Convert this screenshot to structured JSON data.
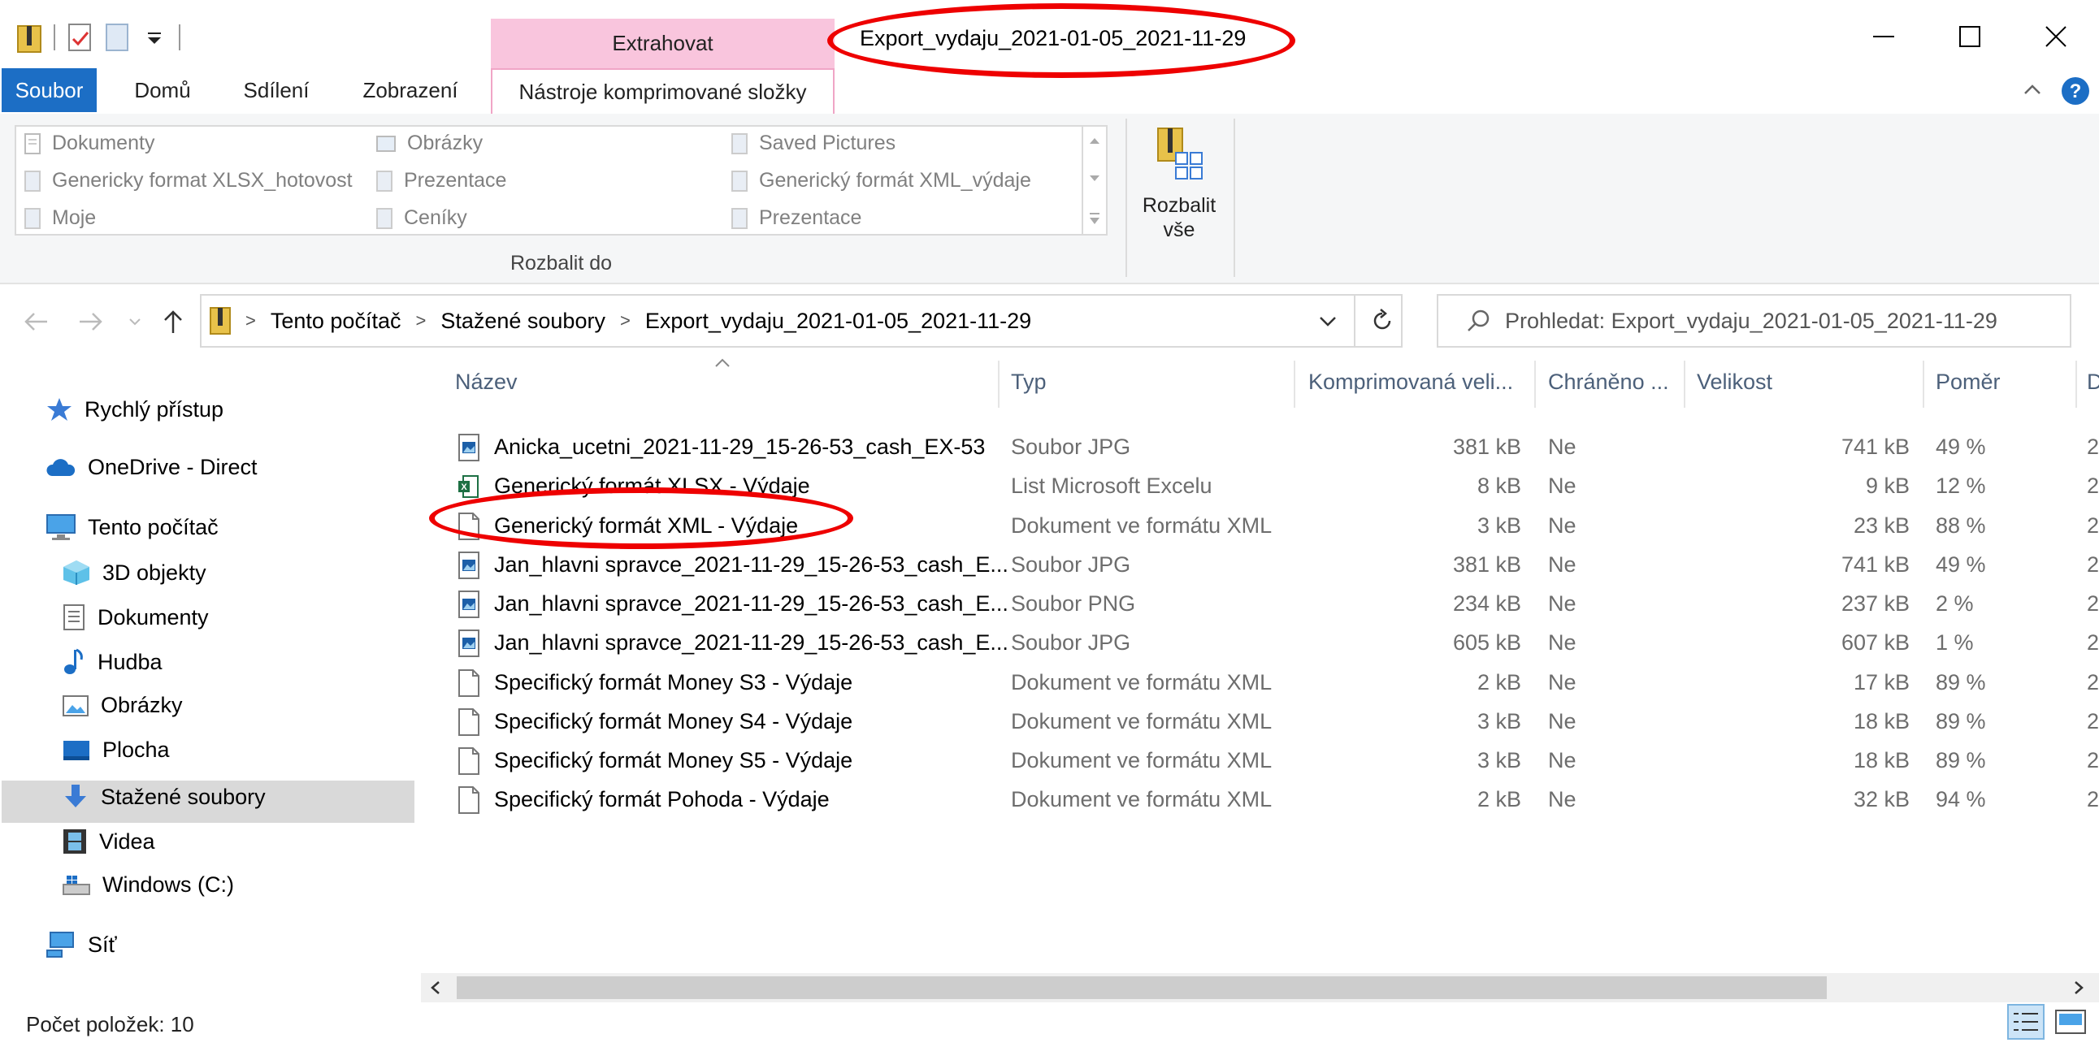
{
  "window": {
    "title": "Export_vydaju_2021-01-05_2021-11-29",
    "context_tab_group": "Extrahovat",
    "minimize_glyph": "—",
    "maximize_glyph": "☐",
    "close_glyph": "✕"
  },
  "ribbon_tabs": {
    "file": "Soubor",
    "home": "Domů",
    "share": "Sdílení",
    "view": "Zobrazení",
    "compressed_tools": "Nástroje komprimované složky"
  },
  "ribbon": {
    "gallery": [
      "Dokumenty",
      "Obrázky",
      "Saved Pictures",
      "Genericky format XLSX_hotovost",
      "Prezentace",
      "Generický formát XML_výdaje",
      "Moje",
      "Ceníky",
      "Prezentace"
    ],
    "gallery_group_label": "Rozbalit do",
    "extract_all_line1": "Rozbalit",
    "extract_all_line2": "vše"
  },
  "address": {
    "crumbs": [
      "Tento počítač",
      "Stažené soubory",
      "Export_vydaju_2021-01-05_2021-11-29"
    ],
    "search_placeholder": "Prohledat: Export_vydaju_2021-01-05_2021-11-29"
  },
  "nav": {
    "quick_access": "Rychlý přístup",
    "onedrive": "OneDrive - Direct",
    "this_pc": "Tento počítač",
    "objects3d": "3D objekty",
    "documents": "Dokumenty",
    "music": "Hudba",
    "pictures": "Obrázky",
    "desktop": "Plocha",
    "downloads": "Stažené soubory",
    "videos": "Videa",
    "windows_c": "Windows (C:)",
    "network": "Síť"
  },
  "columns": {
    "name": "Název",
    "type": "Typ",
    "compressed_size": "Komprimovaná veli...",
    "protected": "Chráněno ...",
    "size": "Velikost",
    "ratio": "Poměr",
    "date": "D"
  },
  "files": [
    {
      "name": "Anicka_ucetni_2021-11-29_15-26-53_cash_EX-53",
      "type": "Soubor JPG",
      "compressed": "381 kB",
      "protected": "Ne",
      "size": "741 kB",
      "ratio": "49 %",
      "date": "2",
      "icon": "image-file-icon"
    },
    {
      "name": "Generický formát XLSX - Výdaje",
      "type": "List Microsoft Excelu",
      "compressed": "8 kB",
      "protected": "Ne",
      "size": "9 kB",
      "ratio": "12 %",
      "date": "2",
      "icon": "excel-file-icon"
    },
    {
      "name": "Generický formát XML - Výdaje",
      "type": "Dokument ve formátu XML",
      "compressed": "3 kB",
      "protected": "Ne",
      "size": "23 kB",
      "ratio": "88 %",
      "date": "2",
      "icon": "xml-file-icon"
    },
    {
      "name": "Jan_hlavni spravce_2021-11-29_15-26-53_cash_E...",
      "type": "Soubor JPG",
      "compressed": "381 kB",
      "protected": "Ne",
      "size": "741 kB",
      "ratio": "49 %",
      "date": "2",
      "icon": "image-file-icon"
    },
    {
      "name": "Jan_hlavni spravce_2021-11-29_15-26-53_cash_E...",
      "type": "Soubor PNG",
      "compressed": "234 kB",
      "protected": "Ne",
      "size": "237 kB",
      "ratio": "2 %",
      "date": "2",
      "icon": "image-file-icon"
    },
    {
      "name": "Jan_hlavni spravce_2021-11-29_15-26-53_cash_E...",
      "type": "Soubor JPG",
      "compressed": "605 kB",
      "protected": "Ne",
      "size": "607 kB",
      "ratio": "1 %",
      "date": "2",
      "icon": "image-file-icon"
    },
    {
      "name": "Specifický formát Money S3 - Výdaje",
      "type": "Dokument ve formátu XML",
      "compressed": "2 kB",
      "protected": "Ne",
      "size": "17 kB",
      "ratio": "89 %",
      "date": "2",
      "icon": "xml-file-icon"
    },
    {
      "name": "Specifický formát Money S4 - Výdaje",
      "type": "Dokument ve formátu XML",
      "compressed": "3 kB",
      "protected": "Ne",
      "size": "18 kB",
      "ratio": "89 %",
      "date": "2",
      "icon": "xml-file-icon"
    },
    {
      "name": "Specifický formát Money S5 - Výdaje",
      "type": "Dokument ve formátu XML",
      "compressed": "3 kB",
      "protected": "Ne",
      "size": "18 kB",
      "ratio": "89 %",
      "date": "2",
      "icon": "xml-file-icon"
    },
    {
      "name": "Specifický formát Pohoda - Výdaje",
      "type": "Dokument ve formátu XML",
      "compressed": "2 kB",
      "protected": "Ne",
      "size": "32 kB",
      "ratio": "94 %",
      "date": "2",
      "icon": "xml-file-icon"
    }
  ],
  "status": {
    "item_count": "Počet položek: 10"
  },
  "colors": {
    "accent": "#1c6ec5",
    "context_tab": "#f9c5dd",
    "annotation": "#e00000"
  }
}
